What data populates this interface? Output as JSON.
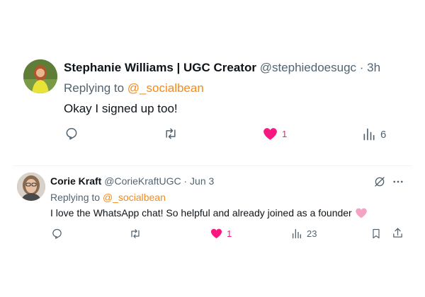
{
  "tweets": [
    {
      "author_name": "Stephanie Williams | UGC Creator",
      "handle": "@stephiedoesugc",
      "time": "· 3h",
      "replying_prefix": "Replying to",
      "replying_to": "@_socialbean",
      "text": "Okay I signed up too!",
      "likes": "1",
      "views": "6",
      "liked": true
    },
    {
      "author_name": "Corie Kraft",
      "handle": "@CorieKraftUGC",
      "time": "· Jun 3",
      "replying_prefix": "Replying to",
      "replying_to": "@_socialbean",
      "text": "I love the WhatsApp chat! So helpful and already joined as a founder",
      "likes": "1",
      "views": "23",
      "liked": true
    }
  ],
  "colors": {
    "like": "#f91880",
    "mention": "#f28b1a",
    "meta": "#536471",
    "text": "#0f1419"
  },
  "icons": [
    "reply-icon",
    "retweet-icon",
    "heart-icon",
    "views-icon",
    "bookmark-icon",
    "share-icon",
    "grok-icon",
    "more-icon",
    "pink-heart-emoji"
  ]
}
